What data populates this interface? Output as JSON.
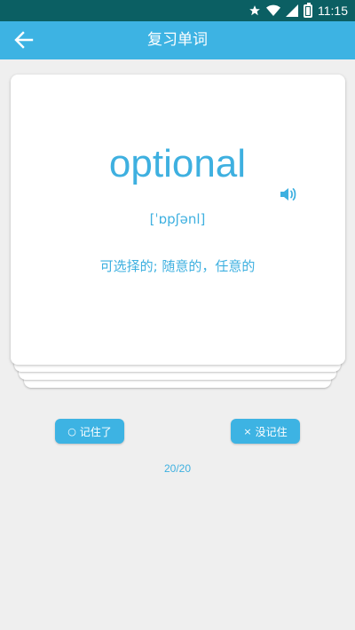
{
  "status_bar": {
    "time": "11:15",
    "icons": [
      "star-icon",
      "wifi-icon",
      "signal-icon",
      "battery-icon"
    ]
  },
  "app_bar": {
    "title": "复习单词",
    "back_icon": "arrow-left-icon"
  },
  "card": {
    "word": "optional",
    "phonetic": "[ˈɒpʃənl]",
    "meaning": "可选择的; 随意的，任意的",
    "speaker_icon": "speaker-icon"
  },
  "actions": {
    "remember_icon": "○",
    "remember_label": "记住了",
    "forgot_icon": "×",
    "forgot_label": "没记住"
  },
  "progress": "20/20",
  "colors": {
    "accent": "#3db3e3",
    "status_bar": "#0b5f63",
    "background": "#efefef"
  }
}
